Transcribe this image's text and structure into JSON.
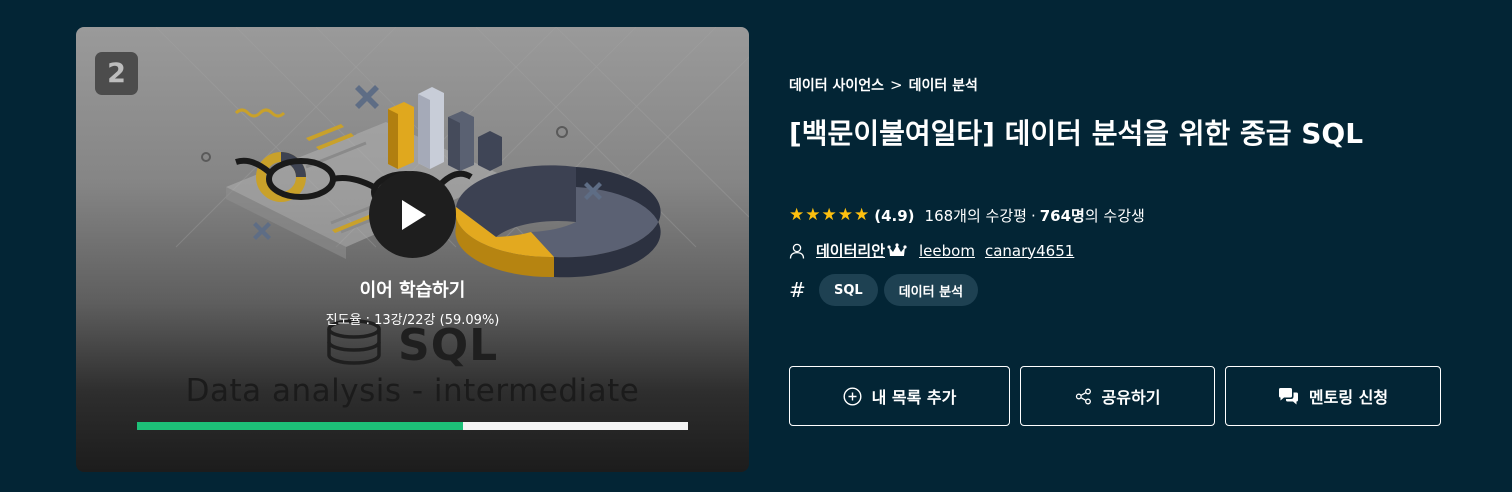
{
  "video": {
    "course_number": "2",
    "resume_label": "이어 학습하기",
    "progress_text": "진도율 : 13강/22강 (59.09%)",
    "progress_fraction": 0.5909,
    "progress_color": "#1dc078",
    "watermark_title": "SQL",
    "watermark_subtitle": "Data analysis - intermediate"
  },
  "course": {
    "breadcrumb": [
      "데이터 사이언스",
      "데이터 분석"
    ],
    "breadcrumb_separator": ">",
    "title": "[백문이불여일타] 데이터 분석을 위한 중급 SQL",
    "rating": "(4.9)",
    "review_count": "168개의 수강평",
    "dot": "·",
    "student_count": "764명",
    "student_suffix": "의 수강생",
    "star_color": "#fdc00f",
    "instructors": [
      "데이터리안",
      "leebom",
      "canary4651"
    ],
    "tags": [
      "SQL",
      "데이터 분석"
    ]
  },
  "actions": {
    "wishlist_label": "내 목록 추가",
    "share_label": "공유하기",
    "mentoring_label": "멘토링 신청"
  }
}
